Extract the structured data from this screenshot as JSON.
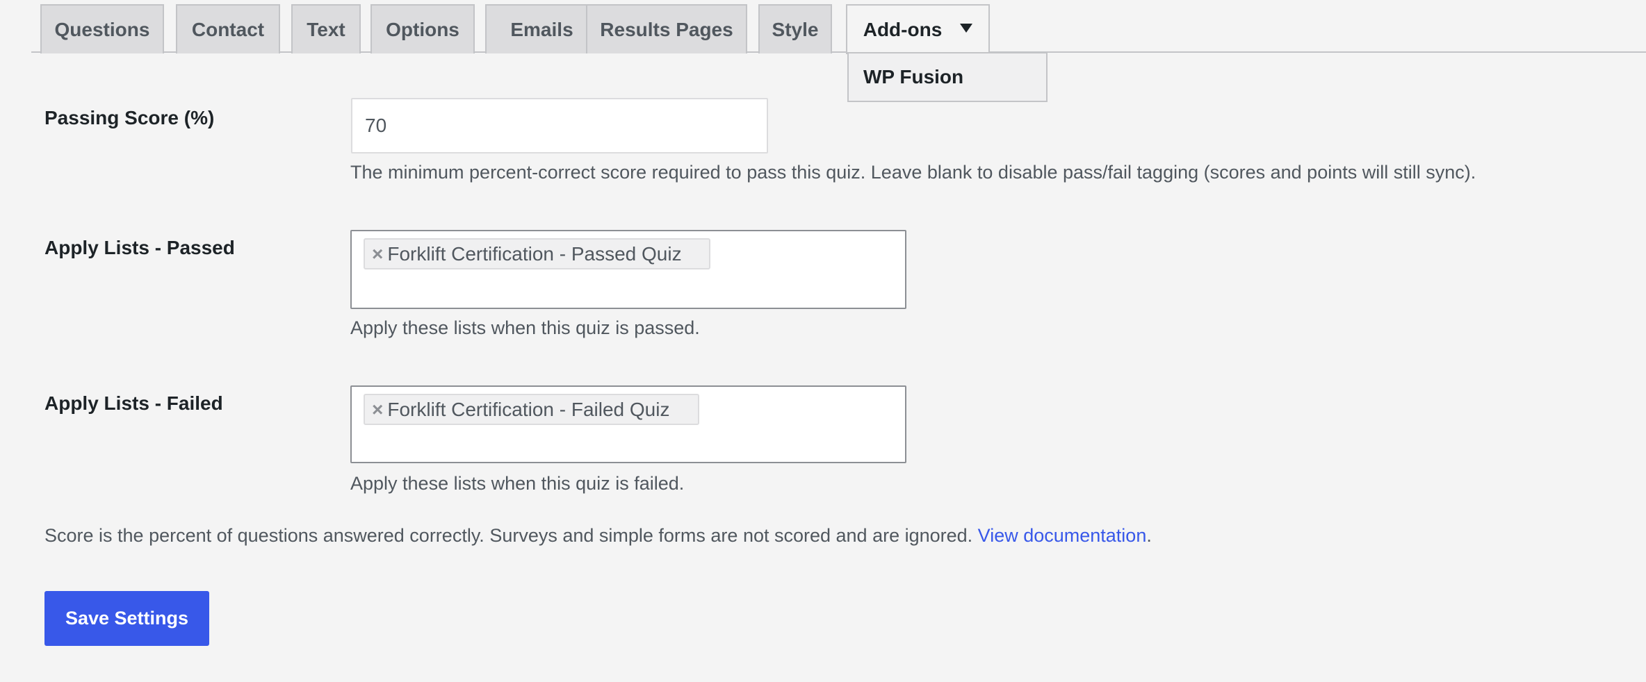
{
  "tabs": [
    {
      "label": "Questions"
    },
    {
      "label": "Contact"
    },
    {
      "label": "Text"
    },
    {
      "label": "Options"
    },
    {
      "label": "Emails"
    },
    {
      "label": "Results Pages"
    },
    {
      "label": "Style"
    },
    {
      "label": "Add-ons",
      "active": true
    }
  ],
  "addons_dropdown": {
    "items": [
      {
        "label": "WP Fusion"
      }
    ]
  },
  "passing_score": {
    "label": "Passing Score (%)",
    "value": "70",
    "help": "The minimum percent-correct score required to pass this quiz. Leave blank to disable pass/fail tagging (scores and points will still sync)."
  },
  "lists_passed": {
    "label": "Apply Lists - Passed",
    "selected": [
      {
        "remove": "×",
        "label": "Forklift Certification - Passed Quiz"
      }
    ],
    "help": "Apply these lists when this quiz is passed."
  },
  "lists_failed": {
    "label": "Apply Lists - Failed",
    "selected": [
      {
        "remove": "×",
        "label": "Forklift Certification - Failed Quiz"
      }
    ],
    "help": "Apply these lists when this quiz is failed."
  },
  "note": {
    "text": "Score is the percent of questions answered correctly. Surveys and simple forms are not scored and are ignored. ",
    "link": "View documentation",
    "suffix": "."
  },
  "save_button": {
    "label": "Save Settings"
  },
  "colors": {
    "primary": "#3858e9",
    "background": "#f4f4f4",
    "tab_inactive": "#dcdcde"
  }
}
